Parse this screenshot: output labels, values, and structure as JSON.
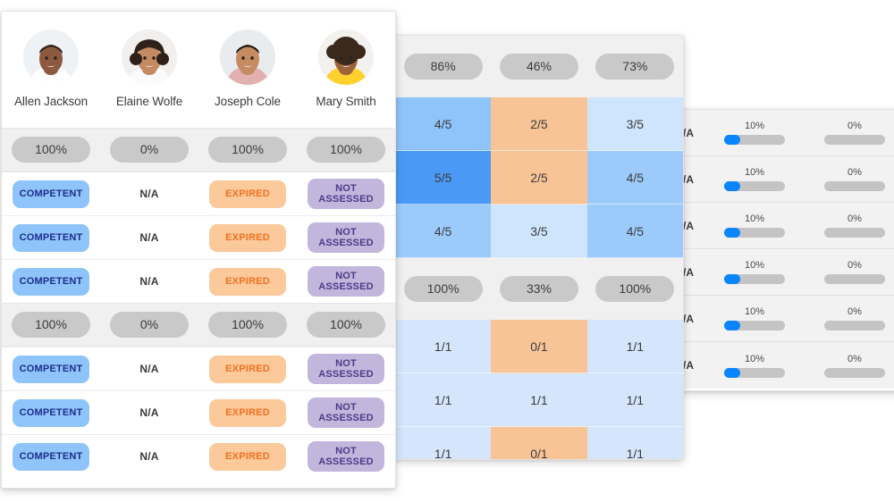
{
  "people_panel": {
    "people": [
      {
        "name": "Allen Jackson",
        "avatar_icon": "avatar-photo-man-1"
      },
      {
        "name": "Elaine Wolfe",
        "avatar_icon": "avatar-photo-woman-1"
      },
      {
        "name": "Joseph Cole",
        "avatar_icon": "avatar-photo-man-2"
      },
      {
        "name": "Mary Smith",
        "avatar_icon": "avatar-photo-woman-2"
      }
    ],
    "rows": [
      {
        "type": "percent",
        "cells": [
          "100%",
          "0%",
          "100%",
          "100%"
        ]
      },
      {
        "type": "status",
        "cells": [
          "COMPETENT",
          "N/A",
          "EXPIRED",
          "NOT ASSESSED"
        ]
      },
      {
        "type": "status",
        "cells": [
          "COMPETENT",
          "N/A",
          "EXPIRED",
          "NOT ASSESSED"
        ]
      },
      {
        "type": "status",
        "cells": [
          "COMPETENT",
          "N/A",
          "EXPIRED",
          "NOT ASSESSED"
        ]
      },
      {
        "type": "percent",
        "cells": [
          "100%",
          "0%",
          "100%",
          "100%"
        ]
      },
      {
        "type": "status",
        "cells": [
          "COMPETENT",
          "N/A",
          "EXPIRED",
          "NOT ASSESSED"
        ]
      },
      {
        "type": "status",
        "cells": [
          "COMPETENT",
          "N/A",
          "EXPIRED",
          "NOT ASSESSED"
        ]
      },
      {
        "type": "status",
        "cells": [
          "COMPETENT",
          "N/A",
          "EXPIRED",
          "NOT ASSESSED"
        ]
      }
    ],
    "colors": {
      "competent_bg": "#8fc4fb",
      "competent_text": "#1d2d8a",
      "expired_bg": "#fbc99a",
      "expired_text": "#f37021",
      "not_assessed_bg": "#c3b6dd",
      "not_assessed_text": "#4a3b86",
      "percent_pill_bg": "#c9c9c9"
    }
  },
  "heatmap_panel": {
    "rows": [
      {
        "type": "percent",
        "cells": [
          "86%",
          "46%",
          "73%"
        ]
      },
      {
        "type": "score",
        "cells": [
          {
            "text": "4/5",
            "bg": "#8fc4fb"
          },
          {
            "text": "2/5",
            "bg": "#f8c496"
          },
          {
            "text": "3/5",
            "bg": "#cfe4fd"
          }
        ]
      },
      {
        "type": "score",
        "cells": [
          {
            "text": "5/5",
            "bg": "#4a9af5"
          },
          {
            "text": "2/5",
            "bg": "#f8c496"
          },
          {
            "text": "4/5",
            "bg": "#9ccbfb"
          }
        ]
      },
      {
        "type": "score",
        "cells": [
          {
            "text": "4/5",
            "bg": "#9ccbfb"
          },
          {
            "text": "3/5",
            "bg": "#cfe4fd"
          },
          {
            "text": "4/5",
            "bg": "#9ccbfb"
          }
        ]
      },
      {
        "type": "percent",
        "cells": [
          "100%",
          "33%",
          "100%"
        ]
      },
      {
        "type": "score",
        "cells": [
          {
            "text": "1/1",
            "bg": "#d5e6fc"
          },
          {
            "text": "0/1",
            "bg": "#f8c496"
          },
          {
            "text": "1/1",
            "bg": "#d5e6fc"
          }
        ]
      },
      {
        "type": "score",
        "cells": [
          {
            "text": "1/1",
            "bg": "#d5e6fc"
          },
          {
            "text": "1/1",
            "bg": "#d5e6fc"
          },
          {
            "text": "1/1",
            "bg": "#d5e6fc"
          }
        ]
      },
      {
        "type": "score",
        "cells": [
          {
            "text": "1/1",
            "bg": "#d5e6fc"
          },
          {
            "text": "0/1",
            "bg": "#f8c496"
          },
          {
            "text": "1/1",
            "bg": "#d5e6fc"
          }
        ]
      }
    ]
  },
  "progress_panel": {
    "accent_color": "#0a84ff",
    "track_color": "#c4c4c4",
    "rows": [
      {
        "left_label": "/A",
        "bars": [
          {
            "label": "10%",
            "value": 10
          },
          {
            "label": "0%",
            "value": 0
          }
        ]
      },
      {
        "left_label": "/A",
        "bars": [
          {
            "label": "10%",
            "value": 10
          },
          {
            "label": "0%",
            "value": 0
          }
        ]
      },
      {
        "left_label": "/A",
        "bars": [
          {
            "label": "10%",
            "value": 10
          },
          {
            "label": "0%",
            "value": 0
          }
        ]
      },
      {
        "left_label": "/A",
        "bars": [
          {
            "label": "10%",
            "value": 10
          },
          {
            "label": "0%",
            "value": 0
          }
        ]
      },
      {
        "left_label": "/A",
        "bars": [
          {
            "label": "10%",
            "value": 10
          },
          {
            "label": "0%",
            "value": 0
          }
        ]
      },
      {
        "left_label": "/A",
        "bars": [
          {
            "label": "10%",
            "value": 10
          },
          {
            "label": "0%",
            "value": 0
          }
        ]
      }
    ]
  }
}
